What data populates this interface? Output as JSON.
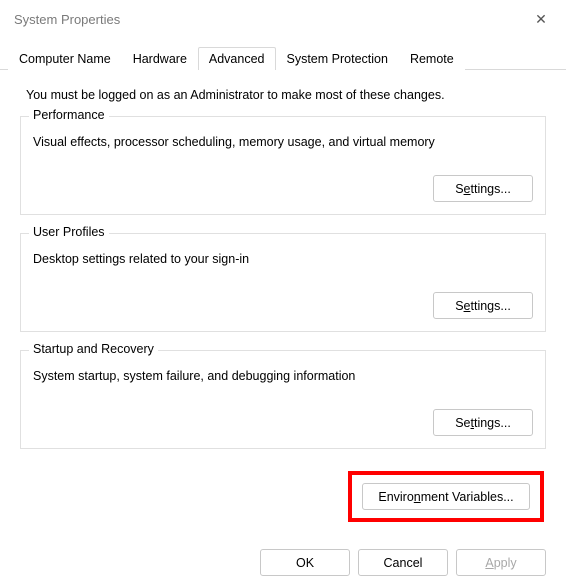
{
  "window": {
    "title": "System Properties"
  },
  "tabs": {
    "computer_name": "Computer Name",
    "hardware": "Hardware",
    "advanced": "Advanced",
    "system_protection": "System Protection",
    "remote": "Remote"
  },
  "info": "You must be logged on as an Administrator to make most of these changes.",
  "groups": {
    "performance": {
      "title": "Performance",
      "desc": "Visual effects, processor scheduling, memory usage, and virtual memory",
      "settings_prefix": "S",
      "settings_u": "e",
      "settings_suffix": "ttings..."
    },
    "user_profiles": {
      "title": "User Profiles",
      "desc": "Desktop settings related to your sign-in",
      "settings_prefix": "S",
      "settings_u": "e",
      "settings_suffix": "ttings..."
    },
    "startup": {
      "title": "Startup and Recovery",
      "desc": "System startup, system failure, and debugging information",
      "settings_prefix": "Se",
      "settings_u": "t",
      "settings_suffix": "tings..."
    }
  },
  "env": {
    "prefix": "Enviro",
    "u": "n",
    "suffix": "ment Variables..."
  },
  "buttons": {
    "ok": "OK",
    "cancel": "Cancel",
    "apply_u": "A",
    "apply_suffix": "pply"
  }
}
